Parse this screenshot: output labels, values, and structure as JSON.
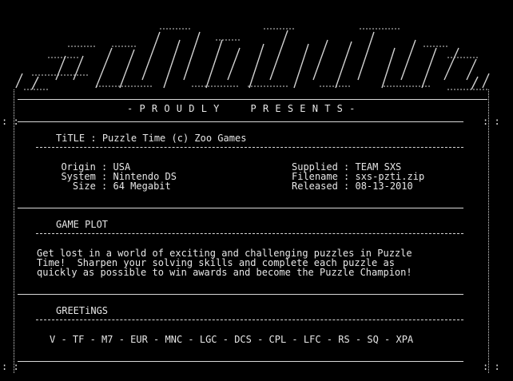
{
  "header": {
    "presents": "- P R O U D L Y     P R E S E N T S -"
  },
  "release": {
    "title_label": "TiTLE",
    "title_value": "Puzzle Time (c) Zoo Games",
    "origin_label": "Origin",
    "origin_value": "USA",
    "system_label": "System",
    "system_value": "Nintendo DS",
    "size_label": "Size",
    "size_value": "64 Megabit",
    "supplied_label": "Supplied",
    "supplied_value": "TEAM SXS",
    "filename_label": "Filename",
    "filename_value": "sxs-pzti.zip",
    "released_label": "Released",
    "released_value": "08-13-2010"
  },
  "plot": {
    "heading": "GAME PLOT",
    "lines": [
      "Get lost in a world of exciting and challenging puzzles in Puzzle",
      "Time!  Sharpen your solving skills and complete each puzzle as",
      "quickly as possible to win awards and become the Puzzle Champion!"
    ]
  },
  "greetings": {
    "heading": "GREETiNGS",
    "list": "V - TF - M7 - EUR - MNC - LGC - DCS - CPL - LFC - RS - SQ - XPA"
  }
}
